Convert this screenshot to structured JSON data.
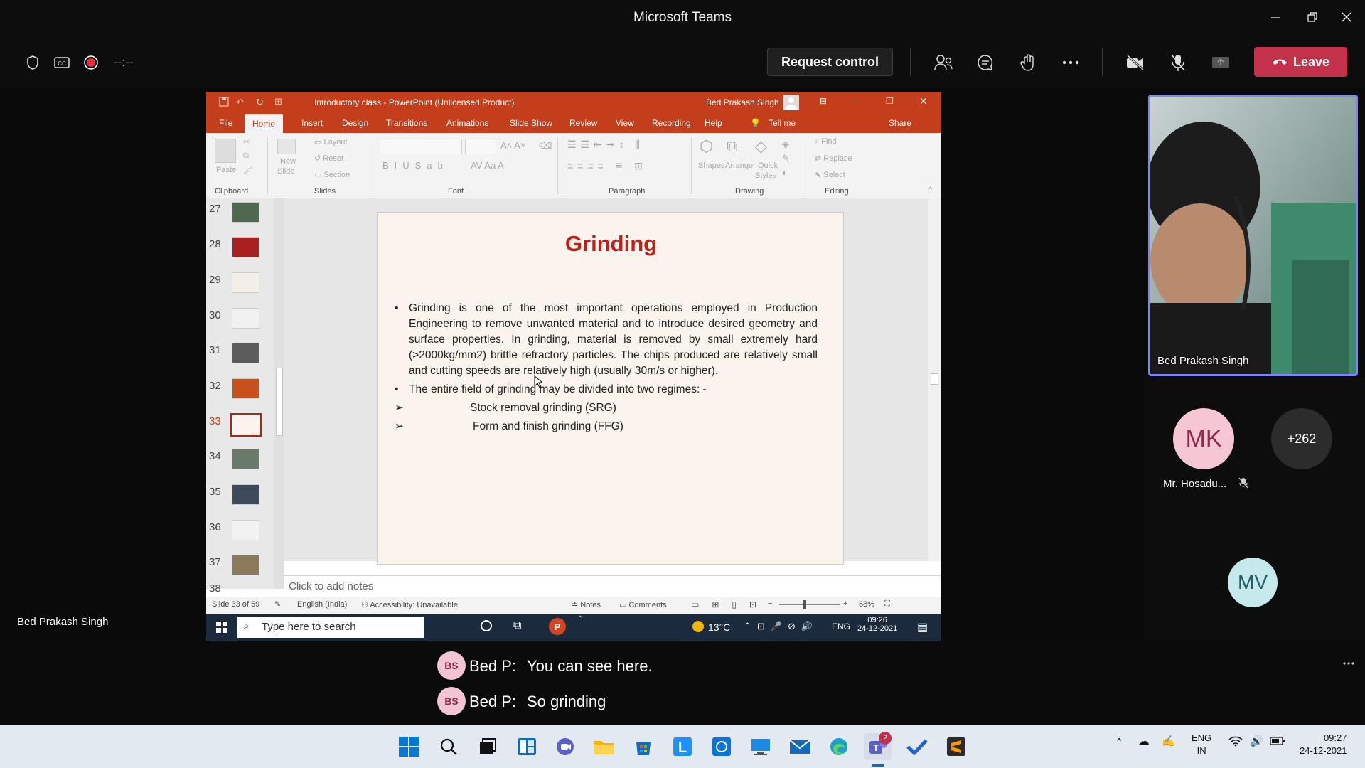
{
  "window": {
    "title": "Microsoft Teams"
  },
  "toolbar": {
    "timer": "--:--",
    "request_control": "Request control",
    "leave": "Leave"
  },
  "ppt": {
    "title": "Introductory class  -  PowerPoint (Unlicensed Product)",
    "user": "Bed Prakash Singh",
    "tabs": [
      "File",
      "Home",
      "Insert",
      "Design",
      "Transitions",
      "Animations",
      "Slide Show",
      "Review",
      "View",
      "Recording",
      "Help",
      "Tell me",
      "Share"
    ],
    "ribbon": {
      "clipboard": {
        "label": "Clipboard",
        "paste": "Paste"
      },
      "slides": {
        "label": "Slides",
        "new_slide": "New",
        "new_slide2": "Slide",
        "layout": "Layout",
        "reset": "Reset",
        "section": "Section"
      },
      "font": {
        "label": "Font"
      },
      "paragraph": {
        "label": "Paragraph"
      },
      "drawing": {
        "label": "Drawing",
        "shapes": "Shapes",
        "arrange": "Arrange",
        "quick": "Quick",
        "styles": "Styles"
      },
      "editing": {
        "label": "Editing",
        "find": "Find",
        "replace": "Replace",
        "select": "Select"
      }
    },
    "thumbnails": [
      "27",
      "28",
      "29",
      "30",
      "31",
      "32",
      "33",
      "34",
      "35",
      "36",
      "37",
      "38"
    ],
    "slide": {
      "heading": "Grinding",
      "bullet1": "Grinding is one of the most important operations employed in Production Engineering to remove unwanted material and to introduce desired geometry and surface properties. In grinding, material is removed by small extremely hard (>2000kg/mm2) brittle refractory particles. The chips produced are relatively small and cutting speeds are relatively high (usually 30m/s or higher).",
      "bullet2": "The entire field of grinding may be divided into two regimes: -",
      "sub1": "Stock removal grinding (SRG)",
      "sub2": "Form and finish grinding (FFG)"
    },
    "notes_placeholder": "Click to add notes",
    "status": {
      "slide": "Slide 33 of 59",
      "lang": "English (India)",
      "access": "Accessibility: Unavailable",
      "notes": "Notes",
      "comments": "Comments",
      "zoom": "68%"
    },
    "win_taskbar": {
      "search": "Type here to search",
      "temp": "13°C",
      "lang": "ENG",
      "time": "09:26",
      "date": "24-12-2021"
    }
  },
  "presenter_label": "Bed Prakash Singh",
  "video": {
    "name": "Bed Prakash Singh"
  },
  "participants": {
    "mk_initials": "MK",
    "mk_name": "Mr. Hosadu...",
    "more": "+262",
    "mv_initials": "MV"
  },
  "captions": [
    {
      "initials": "BS",
      "speaker": "Bed P:",
      "text": "You can see here."
    },
    {
      "initials": "BS",
      "speaker": "Bed P:",
      "text": "So grinding"
    }
  ],
  "taskbar": {
    "lang1": "ENG",
    "lang2": "IN",
    "time": "09:27",
    "date": "24-12-2021",
    "teams_badge": "2"
  },
  "colors": {
    "leave": "#c4314b",
    "ppt_accent": "#c43e1c",
    "speaker_border": "#7f85f5"
  }
}
